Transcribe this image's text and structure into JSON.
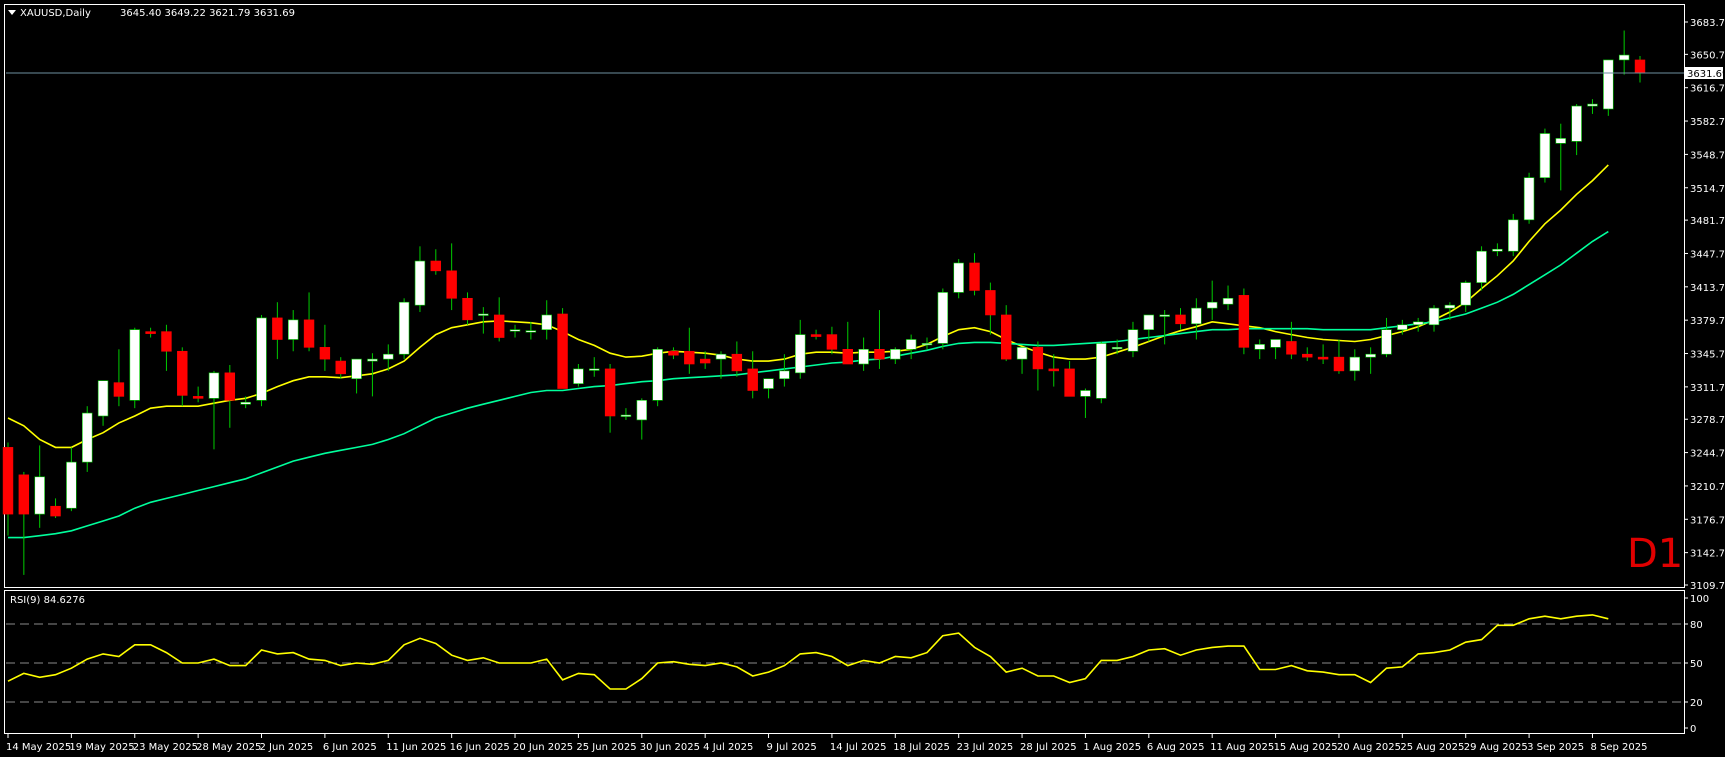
{
  "header": {
    "symbol_label": "XAUUSD,Daily",
    "ohlc_values": "3645.40 3649.22 3621.79 3631.69"
  },
  "timeframe_badge": "D1",
  "colors": {
    "background": "#000000",
    "frame": "#ffffff",
    "bull_body": "#ffffff",
    "bear_body": "#ff0000",
    "wick": "#00cc00",
    "ma_fast": "#ffff00",
    "ma_slow": "#00ff9c",
    "rsi_line": "#ffff00",
    "bid_line": "#6e8fa0",
    "badge": "#e00000"
  },
  "chart_data": [
    {
      "type": "candlestick",
      "title": "XAUUSD,Daily",
      "y_range": [
        3109.7,
        3700.0
      ],
      "y_ticks": [
        3109.7,
        3142.7,
        3176.7,
        3210.7,
        3244.7,
        3278.7,
        3311.7,
        3345.7,
        3379.7,
        3413.7,
        3447.7,
        3481.7,
        3514.7,
        3548.7,
        3582.7,
        3616.7,
        3650.7,
        3683.7
      ],
      "current_price": 3631.69,
      "x_ticks": [
        {
          "index": 0,
          "label": "14 May 2025"
        },
        {
          "index": 4,
          "label": "19 May 2025"
        },
        {
          "index": 8,
          "label": "23 May 2025"
        },
        {
          "index": 12,
          "label": "28 May 2025"
        },
        {
          "index": 16,
          "label": "2 Jun 2025"
        },
        {
          "index": 20,
          "label": "6 Jun 2025"
        },
        {
          "index": 24,
          "label": "11 Jun 2025"
        },
        {
          "index": 28,
          "label": "16 Jun 2025"
        },
        {
          "index": 32,
          "label": "20 Jun 2025"
        },
        {
          "index": 36,
          "label": "25 Jun 2025"
        },
        {
          "index": 40,
          "label": "30 Jun 2025"
        },
        {
          "index": 44,
          "label": "4 Jul 2025"
        },
        {
          "index": 48,
          "label": "9 Jul 2025"
        },
        {
          "index": 52,
          "label": "14 Jul 2025"
        },
        {
          "index": 56,
          "label": "18 Jul 2025"
        },
        {
          "index": 60,
          "label": "23 Jul 2025"
        },
        {
          "index": 64,
          "label": "28 Jul 2025"
        },
        {
          "index": 68,
          "label": "1 Aug 2025"
        },
        {
          "index": 72,
          "label": "6 Aug 2025"
        },
        {
          "index": 76,
          "label": "11 Aug 2025"
        },
        {
          "index": 80,
          "label": "15 Aug 2025"
        },
        {
          "index": 84,
          "label": "20 Aug 2025"
        },
        {
          "index": 88,
          "label": "25 Aug 2025"
        },
        {
          "index": 92,
          "label": "29 Aug 2025"
        },
        {
          "index": 96,
          "label": "3 Sep 2025"
        },
        {
          "index": 100,
          "label": "8 Sep 2025"
        }
      ],
      "ohlc": [
        [
          3250,
          3255,
          3160,
          3182
        ],
        [
          3222,
          3225,
          3120,
          3182
        ],
        [
          3182,
          3252,
          3168,
          3220
        ],
        [
          3190,
          3198,
          3178,
          3180
        ],
        [
          3188,
          3250,
          3185,
          3235
        ],
        [
          3235,
          3292,
          3225,
          3285
        ],
        [
          3282,
          3318,
          3272,
          3318
        ],
        [
          3316,
          3350,
          3292,
          3302
        ],
        [
          3298,
          3372,
          3290,
          3370
        ],
        [
          3368,
          3372,
          3362,
          3366
        ],
        [
          3368,
          3375,
          3328,
          3348
        ],
        [
          3348,
          3352,
          3292,
          3303
        ],
        [
          3302,
          3312,
          3296,
          3300
        ],
        [
          3300,
          3328,
          3248,
          3326
        ],
        [
          3326,
          3334,
          3270,
          3298
        ],
        [
          3294,
          3302,
          3290,
          3296
        ],
        [
          3298,
          3385,
          3292,
          3382
        ],
        [
          3382,
          3398,
          3340,
          3360
        ],
        [
          3360,
          3390,
          3348,
          3380
        ],
        [
          3380,
          3408,
          3348,
          3352
        ],
        [
          3352,
          3375,
          3328,
          3340
        ],
        [
          3338,
          3342,
          3320,
          3325
        ],
        [
          3320,
          3340,
          3305,
          3340
        ],
        [
          3338,
          3346,
          3302,
          3340
        ],
        [
          3340,
          3355,
          3328,
          3345
        ],
        [
          3345,
          3402,
          3340,
          3398
        ],
        [
          3395,
          3455,
          3388,
          3440
        ],
        [
          3440,
          3452,
          3426,
          3430
        ],
        [
          3430,
          3458,
          3390,
          3402
        ],
        [
          3402,
          3408,
          3375,
          3380
        ],
        [
          3385,
          3393,
          3366,
          3386
        ],
        [
          3385,
          3403,
          3358,
          3362
        ],
        [
          3370,
          3375,
          3362,
          3370
        ],
        [
          3368,
          3378,
          3360,
          3369
        ],
        [
          3370,
          3400,
          3360,
          3385
        ],
        [
          3386,
          3392,
          3318,
          3310
        ],
        [
          3315,
          3335,
          3312,
          3330
        ],
        [
          3330,
          3342,
          3322,
          3330
        ],
        [
          3330,
          3335,
          3265,
          3282
        ],
        [
          3282,
          3290,
          3278,
          3283
        ],
        [
          3278,
          3300,
          3258,
          3298
        ],
        [
          3298,
          3352,
          3292,
          3350
        ],
        [
          3348,
          3352,
          3340,
          3344
        ],
        [
          3348,
          3372,
          3325,
          3335
        ],
        [
          3340,
          3348,
          3330,
          3336
        ],
        [
          3340,
          3348,
          3320,
          3345
        ],
        [
          3345,
          3358,
          3322,
          3328
        ],
        [
          3330,
          3348,
          3300,
          3308
        ],
        [
          3310,
          3320,
          3300,
          3320
        ],
        [
          3320,
          3345,
          3312,
          3328
        ],
        [
          3326,
          3380,
          3320,
          3365
        ],
        [
          3365,
          3370,
          3360,
          3363
        ],
        [
          3365,
          3373,
          3345,
          3350
        ],
        [
          3350,
          3378,
          3345,
          3335
        ],
        [
          3335,
          3362,
          3328,
          3350
        ],
        [
          3350,
          3390,
          3330,
          3340
        ],
        [
          3340,
          3352,
          3335,
          3350
        ],
        [
          3350,
          3365,
          3340,
          3360
        ],
        [
          3355,
          3362,
          3350,
          3356
        ],
        [
          3356,
          3412,
          3350,
          3408
        ],
        [
          3408,
          3442,
          3402,
          3438
        ],
        [
          3438,
          3448,
          3405,
          3410
        ],
        [
          3410,
          3418,
          3365,
          3385
        ],
        [
          3385,
          3395,
          3338,
          3340
        ],
        [
          3340,
          3350,
          3325,
          3352
        ],
        [
          3352,
          3358,
          3308,
          3330
        ],
        [
          3330,
          3345,
          3312,
          3328
        ],
        [
          3330,
          3338,
          3318,
          3302
        ],
        [
          3302,
          3310,
          3280,
          3308
        ],
        [
          3300,
          3358,
          3295,
          3356
        ],
        [
          3352,
          3360,
          3345,
          3352
        ],
        [
          3348,
          3378,
          3342,
          3370
        ],
        [
          3370,
          3385,
          3358,
          3385
        ],
        [
          3385,
          3390,
          3355,
          3385
        ],
        [
          3385,
          3392,
          3370,
          3376
        ],
        [
          3376,
          3402,
          3360,
          3392
        ],
        [
          3392,
          3420,
          3380,
          3398
        ],
        [
          3396,
          3415,
          3390,
          3402
        ],
        [
          3405,
          3412,
          3345,
          3352
        ],
        [
          3350,
          3360,
          3340,
          3355
        ],
        [
          3352,
          3360,
          3340,
          3360
        ],
        [
          3358,
          3378,
          3340,
          3345
        ],
        [
          3345,
          3352,
          3338,
          3342
        ],
        [
          3342,
          3355,
          3335,
          3340
        ],
        [
          3342,
          3360,
          3325,
          3328
        ],
        [
          3328,
          3350,
          3318,
          3342
        ],
        [
          3342,
          3352,
          3325,
          3345
        ],
        [
          3345,
          3382,
          3342,
          3370
        ],
        [
          3370,
          3380,
          3365,
          3375
        ],
        [
          3375,
          3382,
          3368,
          3378
        ],
        [
          3375,
          3395,
          3368,
          3392
        ],
        [
          3392,
          3398,
          3380,
          3395
        ],
        [
          3395,
          3420,
          3388,
          3418
        ],
        [
          3418,
          3455,
          3410,
          3450
        ],
        [
          3450,
          3458,
          3445,
          3452
        ],
        [
          3450,
          3488,
          3445,
          3482
        ],
        [
          3482,
          3530,
          3478,
          3525
        ],
        [
          3525,
          3575,
          3520,
          3570
        ],
        [
          3560,
          3580,
          3512,
          3565
        ],
        [
          3562,
          3600,
          3548,
          3598
        ],
        [
          3598,
          3605,
          3590,
          3600
        ],
        [
          3595,
          3645,
          3588,
          3645
        ],
        [
          3645,
          3675,
          3630,
          3650
        ],
        [
          3645,
          3649,
          3622,
          3632
        ]
      ],
      "series": [
        {
          "name": "",
          "values": [
            3280,
            3272,
            3258,
            3250,
            3250,
            3258,
            3265,
            3275,
            3282,
            3290,
            3292,
            3292,
            3292,
            3295,
            3298,
            3300,
            3305,
            3312,
            3318,
            3322,
            3322,
            3321,
            3323,
            3325,
            3330,
            3338,
            3352,
            3365,
            3372,
            3375,
            3378,
            3379,
            3378,
            3377,
            3375,
            3368,
            3360,
            3354,
            3346,
            3342,
            3343,
            3346,
            3348,
            3347,
            3346,
            3344,
            3340,
            3338,
            3338,
            3340,
            3345,
            3347,
            3347,
            3346,
            3347,
            3347,
            3348,
            3350,
            3355,
            3363,
            3370,
            3372,
            3368,
            3360,
            3353,
            3347,
            3342,
            3340,
            3340,
            3342,
            3347,
            3352,
            3358,
            3364,
            3369,
            3373,
            3378,
            3376,
            3374,
            3372,
            3368,
            3365,
            3362,
            3360,
            3359,
            3358,
            3360,
            3364,
            3368,
            3373,
            3380,
            3388,
            3398,
            3412,
            3425,
            3440,
            3460,
            3478,
            3492,
            3508,
            3522,
            3538
          ]
        },
        {
          "name": "",
          "values": [
            3158,
            3158,
            3160,
            3162,
            3165,
            3170,
            3175,
            3180,
            3188,
            3194,
            3198,
            3202,
            3206,
            3210,
            3214,
            3218,
            3224,
            3230,
            3236,
            3240,
            3244,
            3247,
            3250,
            3253,
            3258,
            3264,
            3272,
            3280,
            3285,
            3290,
            3294,
            3298,
            3302,
            3306,
            3308,
            3308,
            3310,
            3312,
            3313,
            3315,
            3317,
            3318,
            3320,
            3321,
            3322,
            3323,
            3324,
            3326,
            3328,
            3330,
            3332,
            3334,
            3336,
            3337,
            3339,
            3340,
            3343,
            3346,
            3349,
            3353,
            3356,
            3357,
            3357,
            3356,
            3355,
            3354,
            3354,
            3355,
            3356,
            3357,
            3358,
            3360,
            3362,
            3364,
            3366,
            3368,
            3370,
            3370,
            3371,
            3371,
            3371,
            3371,
            3371,
            3370,
            3370,
            3370,
            3370,
            3372,
            3374,
            3376,
            3378,
            3382,
            3386,
            3392,
            3398,
            3406,
            3416,
            3426,
            3436,
            3448,
            3460,
            3470
          ]
        }
      ]
    },
    {
      "type": "line",
      "title": "RSI(9) 84.6276",
      "y_range": [
        0,
        100
      ],
      "y_ticks": [
        0,
        20,
        50,
        80,
        100
      ],
      "levels": [
        20,
        50,
        80
      ],
      "series": [
        {
          "name": "",
          "values": [
            36,
            42,
            39,
            41,
            46,
            53,
            57,
            55,
            64,
            64,
            58,
            50,
            50,
            53,
            48,
            48,
            60,
            57,
            58,
            53,
            52,
            48,
            50,
            49,
            52,
            64,
            69,
            65,
            56,
            52,
            54,
            50,
            50,
            50,
            53,
            37,
            42,
            41,
            30,
            30,
            38,
            50,
            51,
            49,
            48,
            50,
            47,
            40,
            43,
            48,
            57,
            58,
            55,
            48,
            52,
            50,
            55,
            54,
            58,
            71,
            73,
            62,
            55,
            43,
            46,
            40,
            40,
            35,
            38,
            52,
            52,
            55,
            60,
            61,
            56,
            60,
            62,
            63,
            63,
            45,
            45,
            48,
            44,
            43,
            41,
            41,
            35,
            46,
            47,
            57,
            58,
            60,
            66,
            68,
            79,
            79,
            84,
            86,
            84,
            86,
            87,
            84
          ]
        }
      ]
    }
  ]
}
